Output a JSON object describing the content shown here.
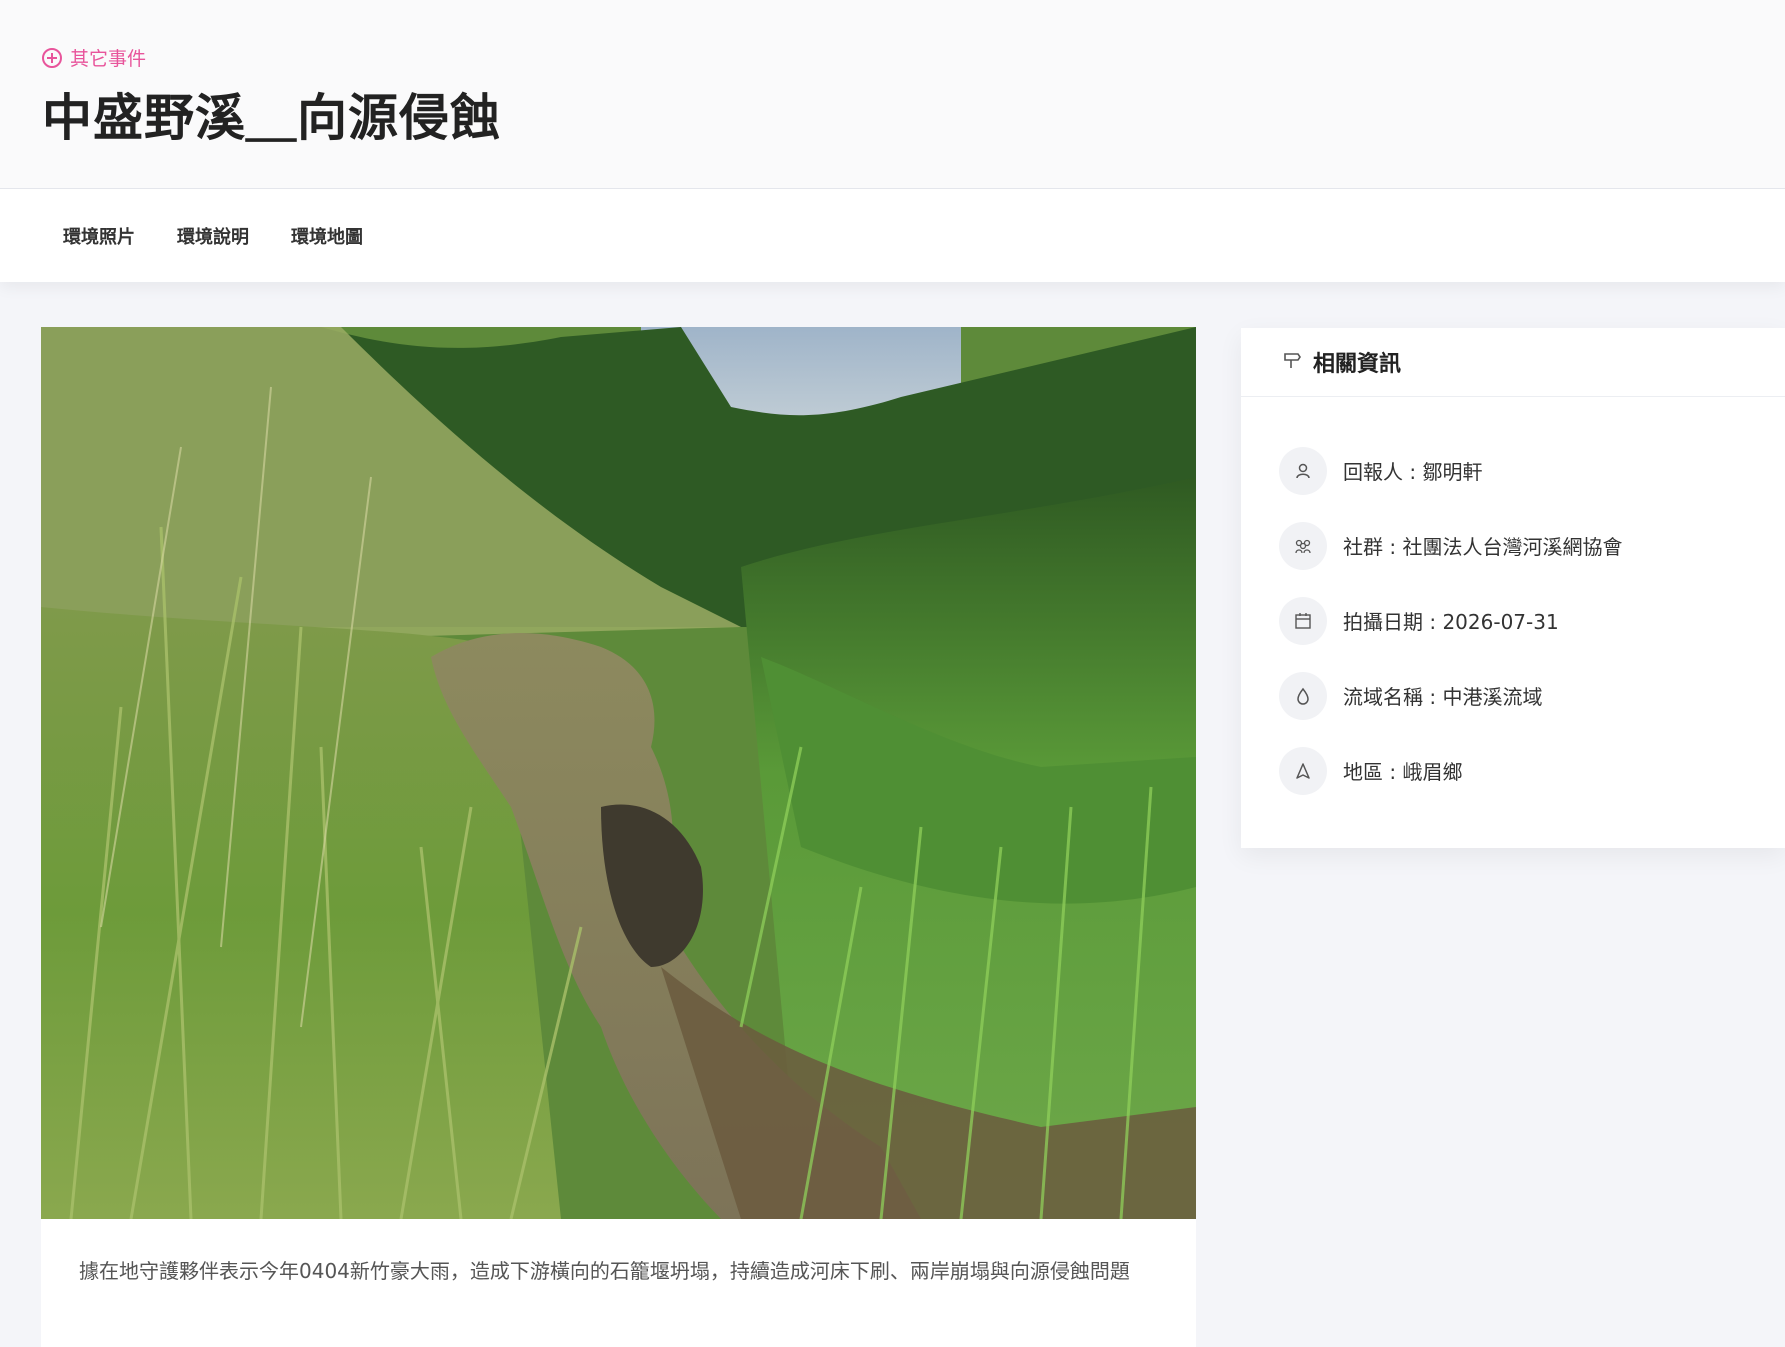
{
  "header": {
    "category_label": "其它事件",
    "title": "中盛野溪＿向源侵蝕"
  },
  "tabs": [
    {
      "label": "環境照片"
    },
    {
      "label": "環境說明"
    },
    {
      "label": "環境地圖"
    }
  ],
  "main": {
    "caption": "據在地守護夥伴表示今年0404新竹豪大雨，造成下游橫向的石籠堰坍塌，持續造成河床下刷、兩岸崩塌與向源侵蝕問題"
  },
  "sidebar": {
    "heading": "相關資訊",
    "items": [
      {
        "icon": "user-icon",
        "text": "回報人 : 鄒明軒"
      },
      {
        "icon": "group-icon",
        "text": "社群 : 社團法人台灣河溪網協會"
      },
      {
        "icon": "calendar-icon",
        "text": "拍攝日期 : 2026-07-31"
      },
      {
        "icon": "water-drop-icon",
        "text": "流域名稱 : 中港溪流域"
      },
      {
        "icon": "location-icon",
        "text": "地區 : 峨眉鄉"
      }
    ]
  },
  "colors": {
    "accent": "#e8549b",
    "background": "#f4f5f9"
  }
}
